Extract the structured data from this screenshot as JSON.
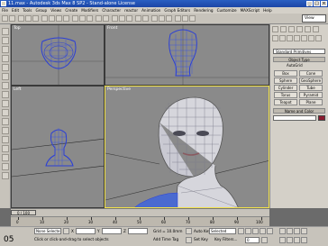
{
  "window": {
    "title": "11.max - Autodesk 3ds Max 8 SP2 - Stand-alone License"
  },
  "menu": [
    "File",
    "Edit",
    "Tools",
    "Group",
    "Views",
    "Create",
    "Modifiers",
    "Character",
    "reactor",
    "Animation",
    "Graph Editors",
    "Rendering",
    "Customize",
    "MAXScript",
    "Help"
  ],
  "toolbar": {
    "view_select": "View"
  },
  "viewports": {
    "top": "Top",
    "front": "Front",
    "left": "Left",
    "perspective": "Perspective"
  },
  "command_panel": {
    "category": "Standard Primitives",
    "object_type_header": "Object Type",
    "autogrid": "AutoGrid",
    "objects": [
      "Box",
      "Cone",
      "Sphere",
      "GeoSphere",
      "Cylinder",
      "Tube",
      "Torus",
      "Pyramid",
      "Teapot",
      "Plane"
    ],
    "name_color_header": "Name and Color",
    "colors": {
      "swatch": "#8b1a2e"
    }
  },
  "timeline": {
    "slider": "0 / 100",
    "ticks": [
      "0",
      "10",
      "20",
      "30",
      "40",
      "50",
      "60",
      "70",
      "80",
      "90",
      "100"
    ]
  },
  "status": {
    "selection": "None Selecte",
    "prompt": "Click or click-and-drag to select objects",
    "x_label": "X",
    "y_label": "Y",
    "z_label": "Z",
    "grid": "Grid = 10.0mm",
    "add_time_tag": "Add Time Tag",
    "auto_key": "Auto Key",
    "selected": "Selected",
    "set_key": "Set Key",
    "key_filters": "Key Filters...",
    "frame": "0",
    "corner_label": "05"
  }
}
